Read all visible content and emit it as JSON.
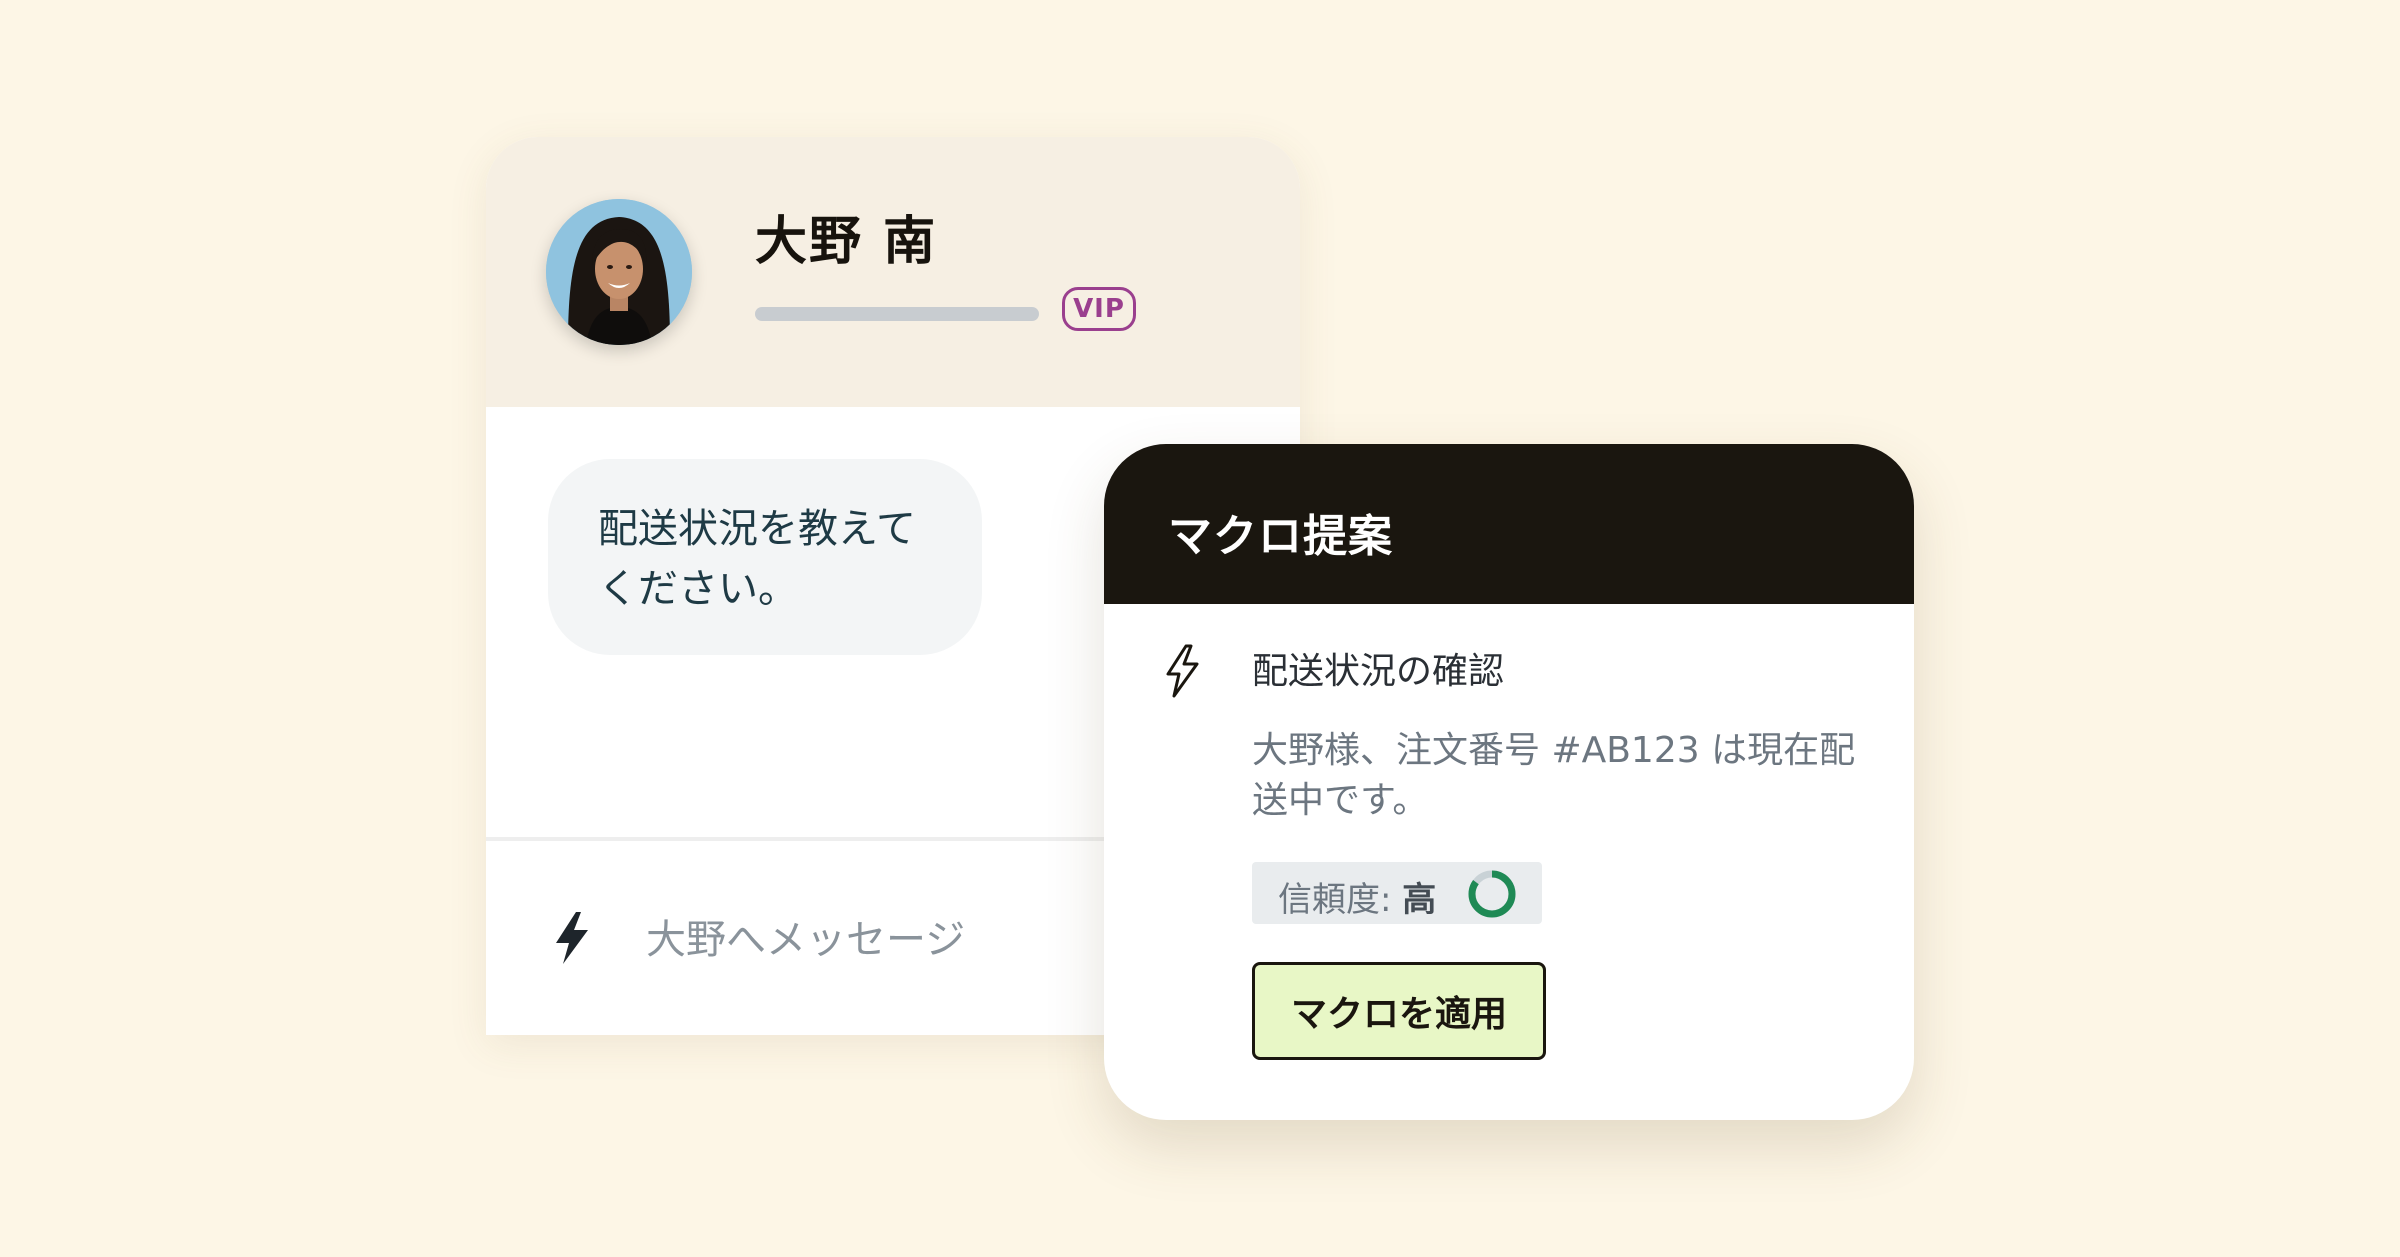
{
  "colors": {
    "page_background": "#fdf6e6",
    "vip_accent": "#9a3f8e",
    "macro_header": "#1a160f",
    "apply_button": "#e8f7c6",
    "confidence_ring": "#1f8a55"
  },
  "chat": {
    "customer": {
      "name": "大野 南",
      "badge": "VIP",
      "avatar_icon": "customer-avatar"
    },
    "message": "配送状況を教えてください。",
    "composer": {
      "icon": "lightning-bolt-icon",
      "placeholder": "大野へメッセージ"
    }
  },
  "macro_panel": {
    "title": "マクロ提案",
    "macro": {
      "icon": "lightning-outline-icon",
      "name": "配送状況の確認",
      "preview": "大野様、注文番号 #AB123 は現在配送中です。"
    },
    "confidence": {
      "label": "信頼度:",
      "value": "高",
      "fraction": 0.85
    },
    "apply_label": "マクロを適用"
  }
}
